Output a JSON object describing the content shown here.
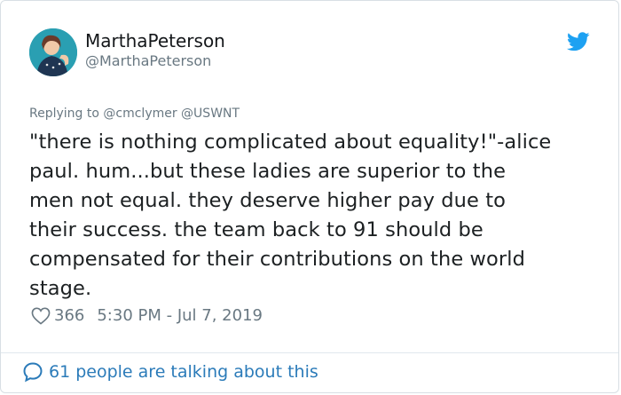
{
  "user": {
    "display_name": "MarthaPeterson",
    "handle": "@MarthaPeterson",
    "avatar_icon": "profile-photo"
  },
  "reply": {
    "prefix": "Replying to",
    "mentions": "@cmclymer @USWNT"
  },
  "tweet": {
    "lines": [
      "\"there is nothing complicated about equality!\"-alice",
      "paul.  hum...but these ladies are superior to the",
      "men not equal.  they deserve higher pay due to",
      "their success. the team back to 91 should be",
      "compensated for their contributions on the world",
      "stage."
    ]
  },
  "meta": {
    "likes": "366",
    "timestamp": "5:30 PM - Jul 7, 2019"
  },
  "footer": {
    "talking": "61 people are talking about this"
  },
  "colors": {
    "twitter_blue": "#1da1f2",
    "link_blue": "#2b7bb9",
    "muted": "#697882"
  }
}
